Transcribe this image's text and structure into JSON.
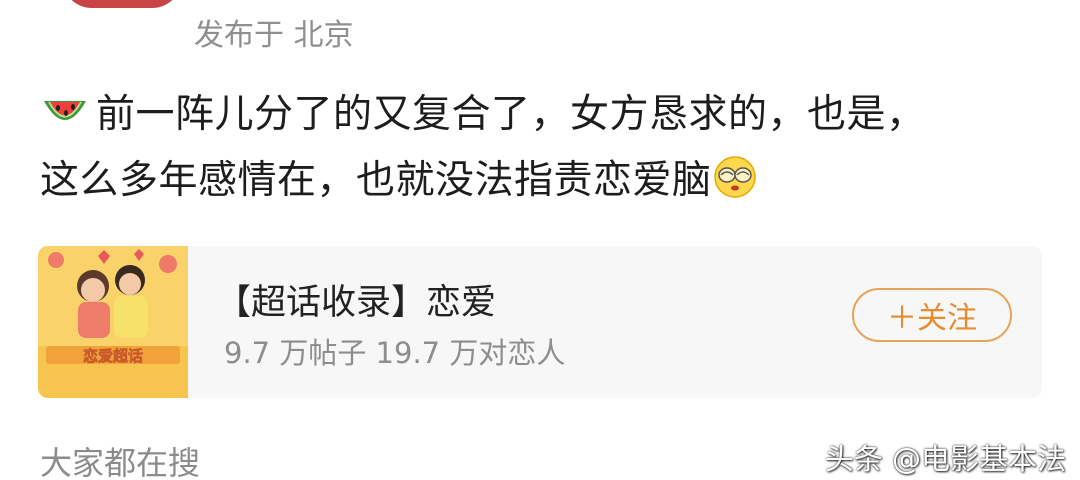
{
  "post": {
    "location": "发布于 北京",
    "line1": "前一阵儿分了的又复合了，女方恳求的，也是，",
    "line2": "这么多年感情在，也就没法指责恋爱脑",
    "emoji_start": "watermelon-icon",
    "emoji_end": "facepalm-icon"
  },
  "topic_card": {
    "cover_text": "恋爱超话",
    "title": "【超话收录】恋爱",
    "stats": "9.7 万帖子 19.7 万对恋人",
    "follow_label": "＋关注"
  },
  "section": {
    "trending_label": "大家都在搜"
  },
  "watermark": "头条 @电影基本法",
  "colors": {
    "follow_accent": "#e88a2e",
    "card_background": "#f7f7f7",
    "secondary_text": "#8f8f8f"
  }
}
